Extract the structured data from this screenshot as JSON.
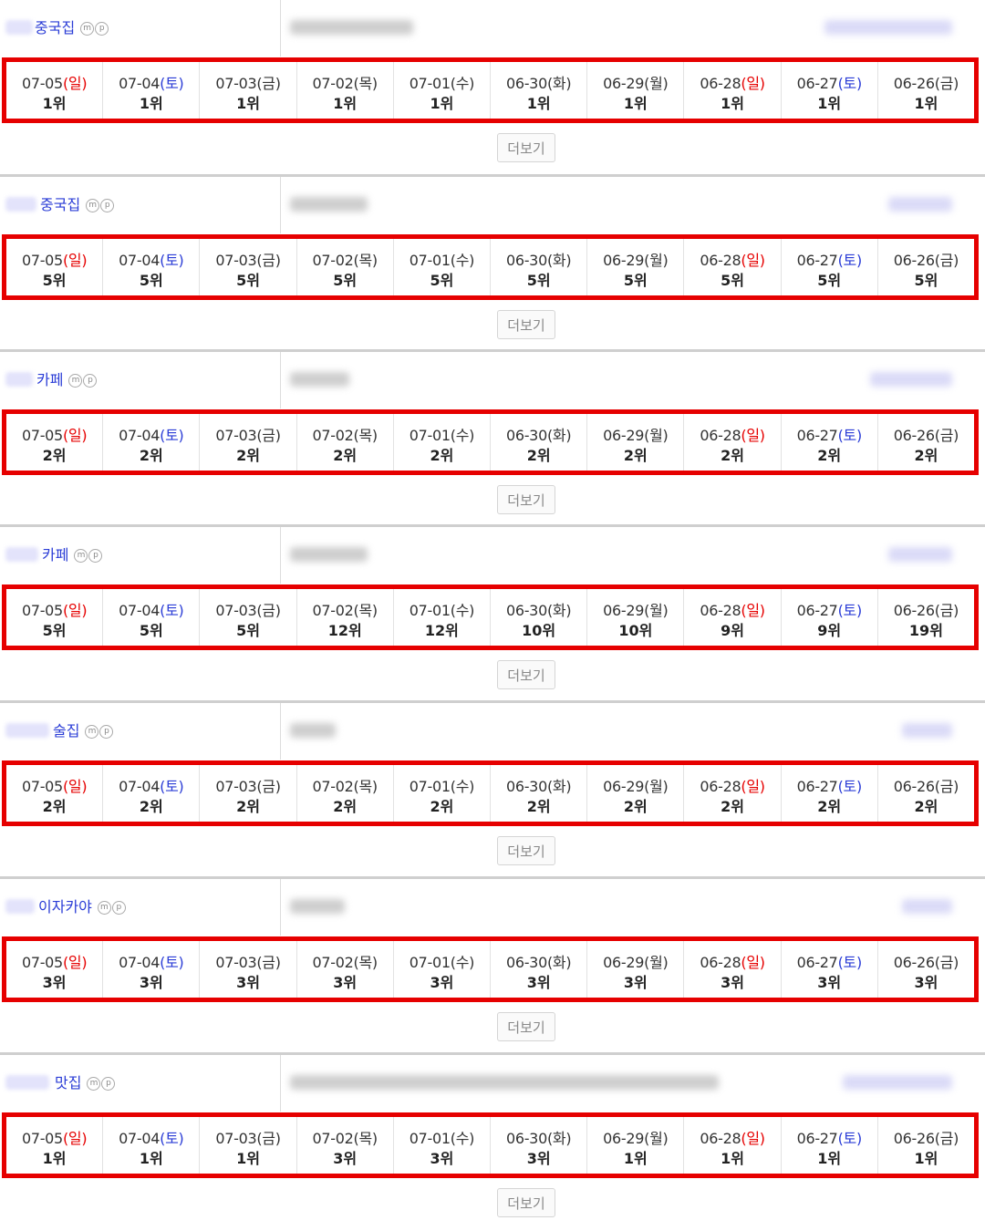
{
  "more_label": "더보기",
  "mp_icons": [
    "m",
    "p"
  ],
  "colors": {
    "highlight_border": "#e60000",
    "sunday": "#e60000",
    "saturday": "#2a3cd6",
    "keyword": "#2a3cd6"
  },
  "dates": [
    {
      "date": "07-05",
      "day": "일",
      "type": "sun"
    },
    {
      "date": "07-04",
      "day": "토",
      "type": "sat"
    },
    {
      "date": "07-03",
      "day": "금",
      "type": "wd"
    },
    {
      "date": "07-02",
      "day": "목",
      "type": "wd"
    },
    {
      "date": "07-01",
      "day": "수",
      "type": "wd"
    },
    {
      "date": "06-30",
      "day": "화",
      "type": "wd"
    },
    {
      "date": "06-29",
      "day": "월",
      "type": "wd"
    },
    {
      "date": "06-28",
      "day": "일",
      "type": "sun"
    },
    {
      "date": "06-27",
      "day": "토",
      "type": "sat"
    },
    {
      "date": "06-26",
      "day": "금",
      "type": "wd"
    }
  ],
  "sections": [
    {
      "keyword": "중국집",
      "ranks": [
        "1위",
        "1위",
        "1위",
        "1위",
        "1위",
        "1위",
        "1위",
        "1위",
        "1위",
        "1위"
      ]
    },
    {
      "keyword": "중국집",
      "ranks": [
        "5위",
        "5위",
        "5위",
        "5위",
        "5위",
        "5위",
        "5위",
        "5위",
        "5위",
        "5위"
      ]
    },
    {
      "keyword": "카페",
      "ranks": [
        "2위",
        "2위",
        "2위",
        "2위",
        "2위",
        "2위",
        "2위",
        "2위",
        "2위",
        "2위"
      ]
    },
    {
      "keyword": "카페",
      "ranks": [
        "5위",
        "5위",
        "5위",
        "12위",
        "12위",
        "10위",
        "10위",
        "9위",
        "9위",
        "19위"
      ]
    },
    {
      "keyword": "술집",
      "ranks": [
        "2위",
        "2위",
        "2위",
        "2위",
        "2위",
        "2위",
        "2위",
        "2위",
        "2위",
        "2위"
      ]
    },
    {
      "keyword": "이자카야",
      "ranks": [
        "3위",
        "3위",
        "3위",
        "3위",
        "3위",
        "3위",
        "3위",
        "3위",
        "3위",
        "3위"
      ]
    },
    {
      "keyword": "맛집",
      "ranks": [
        "1위",
        "1위",
        "1위",
        "3위",
        "3위",
        "3위",
        "1위",
        "1위",
        "1위",
        "1위"
      ]
    }
  ]
}
